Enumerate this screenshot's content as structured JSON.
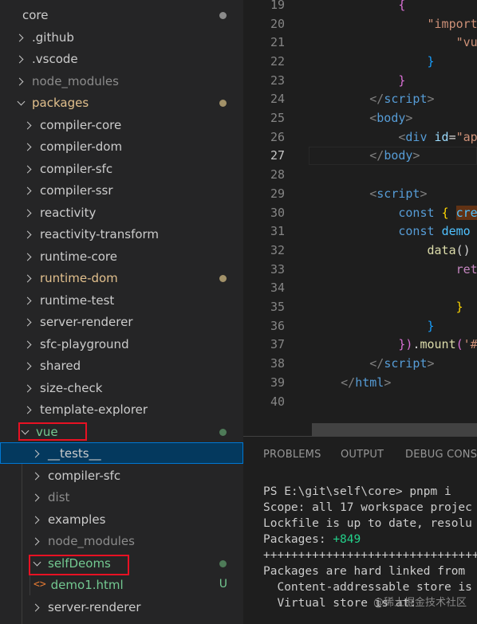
{
  "explorer": {
    "items": [
      {
        "label": "core",
        "chevron": "none",
        "style": "normal",
        "decoration": "gray-dot"
      },
      {
        "label": ".github",
        "chevron": "right",
        "style": "normal",
        "decoration": ""
      },
      {
        "label": ".vscode",
        "chevron": "right",
        "style": "normal",
        "decoration": ""
      },
      {
        "label": "node_modules",
        "chevron": "right",
        "style": "muted",
        "decoration": ""
      },
      {
        "label": "packages",
        "chevron": "down",
        "style": "modified",
        "decoration": "orange-dot"
      },
      {
        "label": "compiler-core",
        "chevron": "right",
        "style": "normal",
        "decoration": ""
      },
      {
        "label": "compiler-dom",
        "chevron": "right",
        "style": "normal",
        "decoration": ""
      },
      {
        "label": "compiler-sfc",
        "chevron": "right",
        "style": "normal",
        "decoration": ""
      },
      {
        "label": "compiler-ssr",
        "chevron": "right",
        "style": "normal",
        "decoration": ""
      },
      {
        "label": "reactivity",
        "chevron": "right",
        "style": "normal",
        "decoration": ""
      },
      {
        "label": "reactivity-transform",
        "chevron": "right",
        "style": "normal",
        "decoration": ""
      },
      {
        "label": "runtime-core",
        "chevron": "right",
        "style": "normal",
        "decoration": ""
      },
      {
        "label": "runtime-dom",
        "chevron": "right",
        "style": "modified",
        "decoration": "orange-dot"
      },
      {
        "label": "runtime-test",
        "chevron": "right",
        "style": "normal",
        "decoration": ""
      },
      {
        "label": "server-renderer",
        "chevron": "right",
        "style": "normal",
        "decoration": ""
      },
      {
        "label": "sfc-playground",
        "chevron": "right",
        "style": "normal",
        "decoration": ""
      },
      {
        "label": "shared",
        "chevron": "right",
        "style": "normal",
        "decoration": ""
      },
      {
        "label": "size-check",
        "chevron": "right",
        "style": "normal",
        "decoration": ""
      },
      {
        "label": "template-explorer",
        "chevron": "right",
        "style": "normal",
        "decoration": ""
      },
      {
        "label": "vue",
        "chevron": "down",
        "style": "untracked",
        "decoration": "green-dot"
      },
      {
        "label": "__tests__",
        "chevron": "right",
        "style": "normal",
        "decoration": ""
      },
      {
        "label": "compiler-sfc",
        "chevron": "right",
        "style": "normal",
        "decoration": ""
      },
      {
        "label": "dist",
        "chevron": "right",
        "style": "muted",
        "decoration": ""
      },
      {
        "label": "examples",
        "chevron": "right",
        "style": "normal",
        "decoration": ""
      },
      {
        "label": "node_modules",
        "chevron": "right",
        "style": "muted",
        "decoration": ""
      },
      {
        "label": "selfDeoms",
        "chevron": "down",
        "style": "untracked",
        "decoration": "green-dot"
      },
      {
        "label": "demo1.html",
        "chevron": "none",
        "style": "untracked",
        "decoration": "U"
      },
      {
        "label": "server-renderer",
        "chevron": "right",
        "style": "normal",
        "decoration": ""
      }
    ]
  },
  "editor": {
    "active_line": "27",
    "lines": [
      {
        "n": "19",
        "code": [
          [
            "            ",
            "t-plain"
          ],
          [
            "{",
            "t-brace2"
          ]
        ]
      },
      {
        "n": "20",
        "code": [
          [
            "                ",
            "t-plain"
          ],
          [
            "\"imports\"",
            "t-str"
          ],
          [
            ":",
            "t-plain"
          ]
        ]
      },
      {
        "n": "21",
        "code": [
          [
            "                    ",
            "t-plain"
          ],
          [
            "\"vue\"",
            "t-str"
          ],
          [
            ":",
            "t-plain"
          ]
        ]
      },
      {
        "n": "22",
        "code": [
          [
            "                ",
            "t-plain"
          ],
          [
            "}",
            "t-brace3"
          ]
        ]
      },
      {
        "n": "23",
        "code": [
          [
            "            ",
            "t-plain"
          ],
          [
            "}",
            "t-brace2"
          ]
        ]
      },
      {
        "n": "24",
        "code": [
          [
            "        ",
            "t-plain"
          ],
          [
            "</",
            "t-ang"
          ],
          [
            "script",
            "t-tag"
          ],
          [
            ">",
            "t-ang"
          ]
        ]
      },
      {
        "n": "25",
        "code": [
          [
            "        ",
            "t-plain"
          ],
          [
            "<",
            "t-ang"
          ],
          [
            "body",
            "t-tag"
          ],
          [
            ">",
            "t-ang"
          ]
        ]
      },
      {
        "n": "26",
        "code": [
          [
            "            ",
            "t-plain"
          ],
          [
            "<",
            "t-ang"
          ],
          [
            "div",
            "t-tag"
          ],
          [
            " ",
            "t-plain"
          ],
          [
            "id",
            "t-attr"
          ],
          [
            "=",
            "t-plain"
          ],
          [
            "\"app\"",
            "t-str"
          ],
          [
            ">",
            "t-ang"
          ]
        ]
      },
      {
        "n": "27",
        "code": [
          [
            "        ",
            "t-plain"
          ],
          [
            "</",
            "t-ang"
          ],
          [
            "body",
            "t-tag"
          ],
          [
            ">",
            "t-ang"
          ]
        ]
      },
      {
        "n": "28",
        "code": []
      },
      {
        "n": "29",
        "code": [
          [
            "        ",
            "t-plain"
          ],
          [
            "<",
            "t-ang"
          ],
          [
            "script",
            "t-tag"
          ],
          [
            ">",
            "t-ang"
          ]
        ]
      },
      {
        "n": "30",
        "code": [
          [
            "            ",
            "t-plain"
          ],
          [
            "const",
            "t-kw"
          ],
          [
            " ",
            "t-plain"
          ],
          [
            "{",
            "t-brace"
          ],
          [
            " ",
            "t-plain"
          ],
          [
            "create",
            "t-var t-hl"
          ]
        ]
      },
      {
        "n": "31",
        "code": [
          [
            "            ",
            "t-plain"
          ],
          [
            "const",
            "t-kw"
          ],
          [
            " ",
            "t-plain"
          ],
          [
            "demo",
            "t-var"
          ],
          [
            " = ",
            "t-plain"
          ],
          [
            "c",
            "t-fn"
          ]
        ]
      },
      {
        "n": "32",
        "code": [
          [
            "                ",
            "t-plain"
          ],
          [
            "data",
            "t-fn"
          ],
          [
            "() ",
            "t-plain"
          ],
          [
            "{",
            "t-brace3"
          ]
        ]
      },
      {
        "n": "33",
        "code": [
          [
            "                    ",
            "t-plain"
          ],
          [
            "return",
            "t-kw2"
          ]
        ]
      },
      {
        "n": "34",
        "code": [
          [
            "                        ",
            "t-plain"
          ],
          [
            "me",
            "t-attr"
          ]
        ]
      },
      {
        "n": "35",
        "code": [
          [
            "                    ",
            "t-plain"
          ],
          [
            "}",
            "t-brace"
          ]
        ]
      },
      {
        "n": "36",
        "code": [
          [
            "                ",
            "t-plain"
          ],
          [
            "}",
            "t-brace3"
          ]
        ]
      },
      {
        "n": "37",
        "code": [
          [
            "            ",
            "t-plain"
          ],
          [
            "})",
            "t-brace2"
          ],
          [
            ".",
            "t-plain"
          ],
          [
            "mount",
            "t-fn"
          ],
          [
            "(",
            "t-brace2"
          ],
          [
            "'#app",
            "t-str"
          ]
        ]
      },
      {
        "n": "38",
        "code": [
          [
            "        ",
            "t-plain"
          ],
          [
            "</",
            "t-ang"
          ],
          [
            "script",
            "t-tag"
          ],
          [
            ">",
            "t-ang"
          ]
        ]
      },
      {
        "n": "39",
        "code": [
          [
            "    ",
            "t-plain"
          ],
          [
            "</",
            "t-ang"
          ],
          [
            "html",
            "t-tag"
          ],
          [
            ">",
            "t-ang"
          ]
        ]
      },
      {
        "n": "40",
        "code": []
      }
    ]
  },
  "panel": {
    "tabs": [
      "PROBLEMS",
      "OUTPUT",
      "DEBUG CONSO"
    ],
    "terminal": {
      "line1": "PS E:\\git\\self\\core> pnpm i",
      "line2": "Scope: all 17 workspace projec",
      "line3": "Lockfile is up to date, resolu",
      "line4_label": "Packages: ",
      "line4_value": "+849",
      "line5": "++++++++++++++++++++++++++++++++",
      "line6": "Packages are hard linked from",
      "line7": "  Content-addressable store is",
      "line8": "  Virtual store is at:"
    }
  },
  "watermark": "@稀土掘金技术社区",
  "colors": {
    "sidebar_bg": "#252526",
    "editor_bg": "#1e1e1e",
    "selection": "#04395e",
    "focus_border": "#0078d4",
    "annotation_red": "#e81123",
    "modified": "#e2c08d",
    "untracked": "#73c991"
  }
}
